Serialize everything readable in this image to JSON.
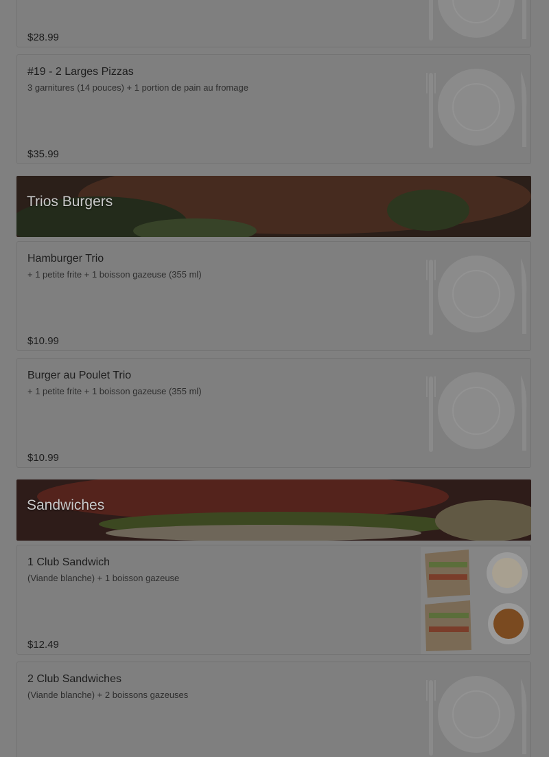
{
  "items_top": [
    {
      "title": "",
      "description": "",
      "price": "$28.99"
    },
    {
      "title": "#19 - 2 Larges Pizzas",
      "description": "3 garnitures (14 pouces) + 1 portion de pain au fromage",
      "price": "$35.99"
    }
  ],
  "categories": [
    {
      "name": "Trios Burgers",
      "items": [
        {
          "title": "Hamburger Trio",
          "description": "+ 1 petite frite + 1 boisson gazeuse (355 ml)",
          "price": "$10.99"
        },
        {
          "title": "Burger au Poulet Trio",
          "description": "+ 1 petite frite + 1 boisson gazeuse (355 ml)",
          "price": "$10.99"
        }
      ]
    },
    {
      "name": "Sandwiches",
      "items": [
        {
          "title": "1 Club Sandwich",
          "description": "(Viande blanche) + 1 boisson gazeuse",
          "price": "$12.49",
          "image": "club-sandwich-photo"
        },
        {
          "title": "2 Club Sandwiches",
          "description": "(Viande blanche) + 2 boissons gazeuses",
          "price": ""
        }
      ]
    }
  ],
  "colors": {
    "overlay": "#808080",
    "card_bg": "#7f7f7f",
    "text_dark": "#1d1d1d",
    "placeholder_plate": "#8c8c8c"
  },
  "icons": {
    "placeholder": "plate-fork-knife-icon"
  }
}
